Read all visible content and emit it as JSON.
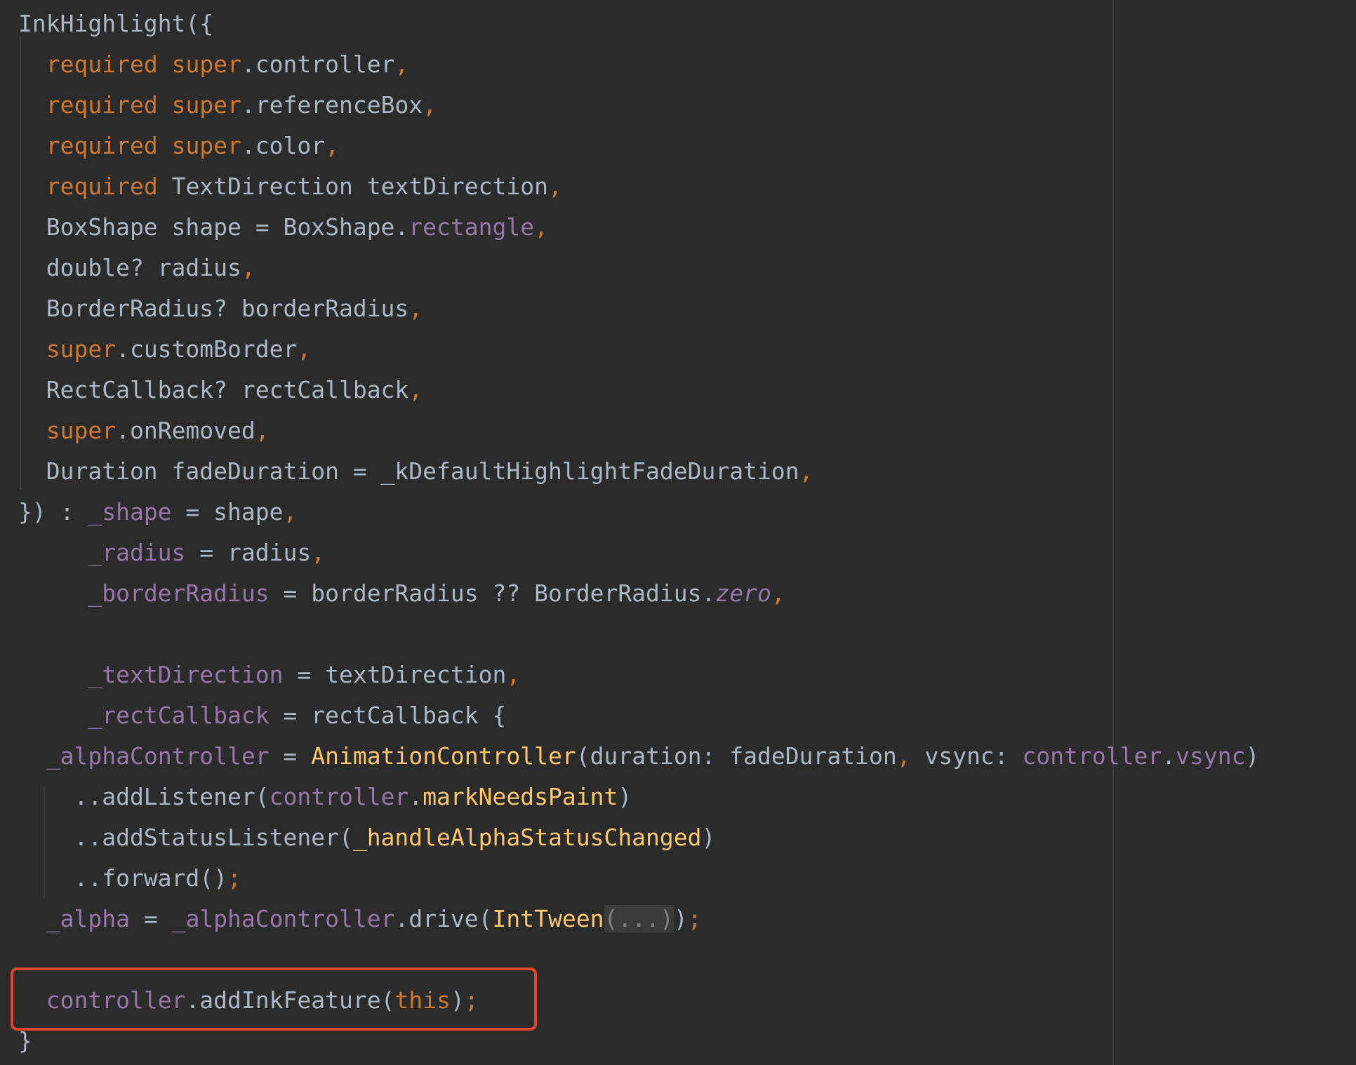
{
  "editor": {
    "accent_colors": {
      "background": "#2b2b2b",
      "text": "#a9b7c6",
      "keyword": "#cc7832",
      "field": "#9876aa",
      "function": "#ffc66d",
      "highlight_box": "#e0442b"
    },
    "lines": [
      [
        {
          "t": "InkHighlight({",
          "c": "p"
        }
      ],
      [
        {
          "t": "  "
        },
        {
          "t": "required",
          "c": "kw"
        },
        {
          "t": " "
        },
        {
          "t": "super",
          "c": "kw"
        },
        {
          "t": ".controller"
        },
        {
          "t": ",",
          "c": "kw"
        }
      ],
      [
        {
          "t": "  "
        },
        {
          "t": "required",
          "c": "kw"
        },
        {
          "t": " "
        },
        {
          "t": "super",
          "c": "kw"
        },
        {
          "t": ".referenceBox"
        },
        {
          "t": ",",
          "c": "kw"
        }
      ],
      [
        {
          "t": "  "
        },
        {
          "t": "required",
          "c": "kw"
        },
        {
          "t": " "
        },
        {
          "t": "super",
          "c": "kw"
        },
        {
          "t": ".color"
        },
        {
          "t": ",",
          "c": "kw"
        }
      ],
      [
        {
          "t": "  "
        },
        {
          "t": "required",
          "c": "kw"
        },
        {
          "t": " TextDirection textDirection"
        },
        {
          "t": ",",
          "c": "kw"
        }
      ],
      [
        {
          "t": "  BoxShape shape = BoxShape."
        },
        {
          "t": "rectangle",
          "c": "fld"
        },
        {
          "t": ",",
          "c": "kw"
        }
      ],
      [
        {
          "t": "  double? radius"
        },
        {
          "t": ",",
          "c": "kw"
        }
      ],
      [
        {
          "t": "  BorderRadius? borderRadius"
        },
        {
          "t": ",",
          "c": "kw"
        }
      ],
      [
        {
          "t": "  "
        },
        {
          "t": "super",
          "c": "kw"
        },
        {
          "t": ".customBorder"
        },
        {
          "t": ",",
          "c": "kw"
        }
      ],
      [
        {
          "t": "  RectCallback? rectCallback"
        },
        {
          "t": ",",
          "c": "kw"
        }
      ],
      [
        {
          "t": "  "
        },
        {
          "t": "super",
          "c": "kw"
        },
        {
          "t": ".onRemoved"
        },
        {
          "t": ",",
          "c": "kw"
        }
      ],
      [
        {
          "t": "  Duration fadeDuration = _kDefaultHighlightFadeDuration"
        },
        {
          "t": ",",
          "c": "kw"
        }
      ],
      [
        {
          "t": "}) : "
        },
        {
          "t": "_shape",
          "c": "fld"
        },
        {
          "t": " = shape"
        },
        {
          "t": ",",
          "c": "kw"
        }
      ],
      [
        {
          "t": "     "
        },
        {
          "t": "_radius",
          "c": "fld"
        },
        {
          "t": " = radius"
        },
        {
          "t": ",",
          "c": "kw"
        }
      ],
      [
        {
          "t": "     "
        },
        {
          "t": "_borderRadius",
          "c": "fld"
        },
        {
          "t": " = borderRadius ?? BorderRadius."
        },
        {
          "t": "zero",
          "c": "fld it"
        },
        {
          "t": ",",
          "c": "kw"
        }
      ],
      [],
      [
        {
          "t": "     "
        },
        {
          "t": "_textDirection",
          "c": "fld"
        },
        {
          "t": " = textDirection"
        },
        {
          "t": ",",
          "c": "kw"
        }
      ],
      [
        {
          "t": "     "
        },
        {
          "t": "_rectCallback",
          "c": "fld"
        },
        {
          "t": " = rectCallback {"
        }
      ],
      [
        {
          "t": "  "
        },
        {
          "t": "_alphaController",
          "c": "fld"
        },
        {
          "t": " = "
        },
        {
          "t": "AnimationController",
          "c": "fn"
        },
        {
          "t": "(duration: fadeDuration"
        },
        {
          "t": ",",
          "c": "kw"
        },
        {
          "t": " vsync: "
        },
        {
          "t": "controller",
          "c": "fld"
        },
        {
          "t": "."
        },
        {
          "t": "vsync",
          "c": "fld"
        },
        {
          "t": ")"
        }
      ],
      [
        {
          "t": "    ..addListener("
        },
        {
          "t": "controller",
          "c": "fld"
        },
        {
          "t": "."
        },
        {
          "t": "markNeedsPaint",
          "c": "fn"
        },
        {
          "t": ")"
        }
      ],
      [
        {
          "t": "    ..addStatusListener("
        },
        {
          "t": "_handleAlphaStatusChanged",
          "c": "fn"
        },
        {
          "t": ")"
        }
      ],
      [
        {
          "t": "    ..forward()"
        },
        {
          "t": ";",
          "c": "kw"
        }
      ],
      [
        {
          "t": "  "
        },
        {
          "t": "_alpha",
          "c": "fld"
        },
        {
          "t": " = "
        },
        {
          "t": "_alphaController",
          "c": "fld"
        },
        {
          "t": ".drive("
        },
        {
          "t": "IntTween",
          "c": "fn"
        },
        {
          "t": "(...)",
          "c": "fold"
        },
        {
          "t": ")"
        },
        {
          "t": ";",
          "c": "kw"
        }
      ],
      [],
      [
        {
          "t": "  "
        },
        {
          "t": "controller",
          "c": "fld"
        },
        {
          "t": ".addInkFeature("
        },
        {
          "t": "this",
          "c": "kw"
        },
        {
          "t": ")"
        },
        {
          "t": ";",
          "c": "kw"
        }
      ],
      [
        {
          "t": "}"
        }
      ]
    ]
  }
}
